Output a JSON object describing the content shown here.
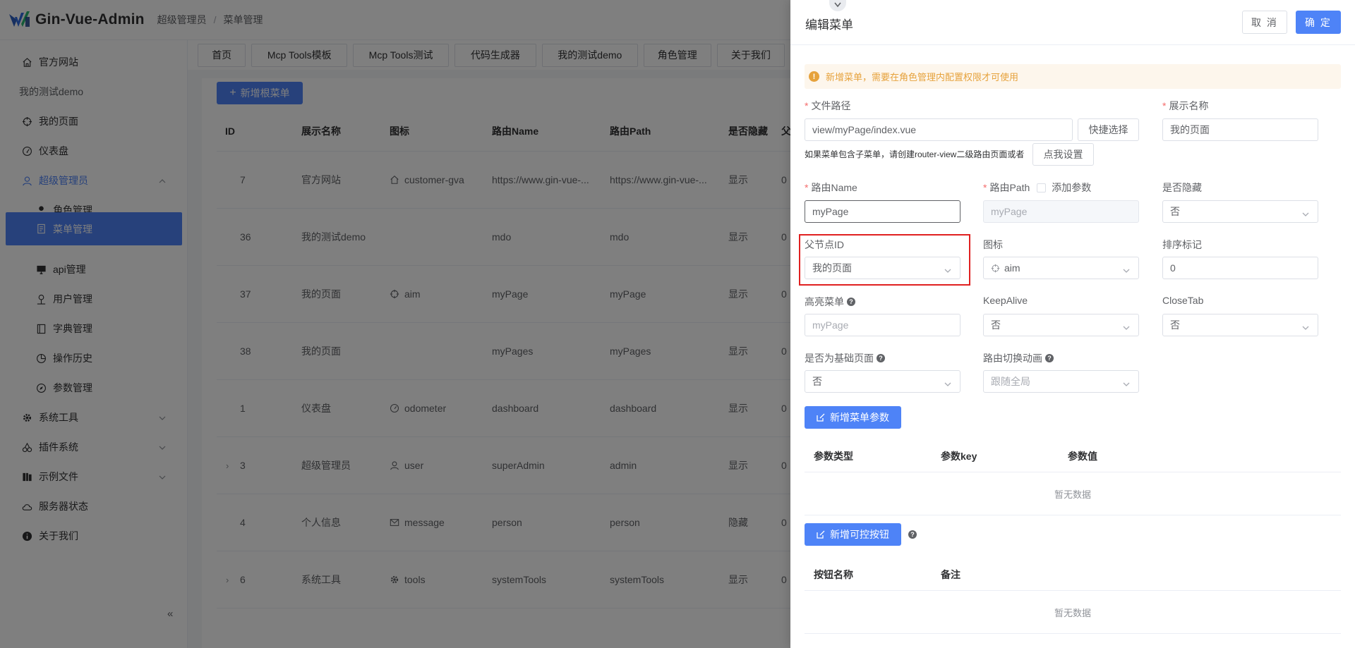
{
  "app": {
    "name": "Gin-Vue-Admin"
  },
  "breadcrumb": [
    "超级管理员",
    "菜单管理"
  ],
  "sidebar": {
    "items": [
      {
        "label": "官方网站",
        "icon": "home-icon"
      },
      {
        "label": "我的测试demo",
        "icon": ""
      },
      {
        "label": "我的页面",
        "icon": "aim-icon"
      },
      {
        "label": "仪表盘",
        "icon": "odometer-icon"
      },
      {
        "label": "超级管理员",
        "icon": "user-icon"
      },
      {
        "label": "角色管理",
        "icon": "avatar-icon"
      },
      {
        "label": "菜单管理",
        "icon": "tickets-icon"
      },
      {
        "label": "api管理",
        "icon": "platform-icon"
      },
      {
        "label": "用户管理",
        "icon": "coordinate-icon"
      },
      {
        "label": "字典管理",
        "icon": "notebook-icon"
      },
      {
        "label": "操作历史",
        "icon": "pie-chart-icon"
      },
      {
        "label": "参数管理",
        "icon": "compass-icon"
      },
      {
        "label": "系统工具",
        "icon": "tools-icon"
      },
      {
        "label": "插件系统",
        "icon": "cherry-icon"
      },
      {
        "label": "示例文件",
        "icon": "management-icon"
      },
      {
        "label": "服务器状态",
        "icon": "cloudy-icon"
      },
      {
        "label": "关于我们",
        "icon": "info-icon"
      }
    ],
    "collapse_glyph": "«"
  },
  "tabs": [
    "首页",
    "Mcp Tools模板",
    "Mcp Tools测试",
    "代码生成器",
    "我的测试demo",
    "角色管理",
    "关于我们"
  ],
  "main": {
    "add_root_label": "新增根菜单",
    "add_root_glyph": "+",
    "table": {
      "headers": [
        "ID",
        "展示名称",
        "图标",
        "路由Name",
        "路由Path",
        "是否隐藏",
        "父"
      ],
      "rows": [
        {
          "expand": "",
          "id": "7",
          "name": "官方网站",
          "icon": "customer-gva",
          "route_name": "https://www.gin-vue-...",
          "route_path": "https://www.gin-vue-...",
          "hidden": "显示",
          "more": "0"
        },
        {
          "expand": "",
          "id": "36",
          "name": "我的测试demo",
          "icon": "",
          "route_name": "mdo",
          "route_path": "mdo",
          "hidden": "显示",
          "more": "0"
        },
        {
          "expand": "",
          "id": "37",
          "name": "我的页面",
          "icon": "aim",
          "route_name": "myPage",
          "route_path": "myPage",
          "hidden": "显示",
          "more": "0"
        },
        {
          "expand": "",
          "id": "38",
          "name": "我的页面",
          "icon": "",
          "route_name": "myPages",
          "route_path": "myPages",
          "hidden": "显示",
          "more": "0"
        },
        {
          "expand": "",
          "id": "1",
          "name": "仪表盘",
          "icon": "odometer",
          "route_name": "dashboard",
          "route_path": "dashboard",
          "hidden": "显示",
          "more": "0"
        },
        {
          "expand": "›",
          "id": "3",
          "name": "超级管理员",
          "icon": "user",
          "route_name": "superAdmin",
          "route_path": "admin",
          "hidden": "显示",
          "more": "0"
        },
        {
          "expand": "",
          "id": "4",
          "name": "个人信息",
          "icon": "message",
          "route_name": "person",
          "route_path": "person",
          "hidden": "隐藏",
          "more": "0"
        },
        {
          "expand": "›",
          "id": "6",
          "name": "系统工具",
          "icon": "tools",
          "route_name": "systemTools",
          "route_path": "systemTools",
          "hidden": "显示",
          "more": "0"
        }
      ]
    }
  },
  "drawer": {
    "title": "编辑菜单",
    "cancel_label": "取 消",
    "ok_label": "确 定",
    "alert": "新增菜单，需要在角色管理内配置权限才可使用",
    "alert_glyph": "!",
    "required_mark": "*",
    "help_glyph": "?",
    "file_path": {
      "label": "文件路径",
      "value": "view/myPage/index.vue",
      "quick_btn": "快捷选择"
    },
    "display_name": {
      "label": "展示名称",
      "value": "我的页面"
    },
    "hint": "如果菜单包含子菜单，请创建router-view二级路由页面或者",
    "hint_btn": "点我设置",
    "route_name": {
      "label": "路由Name",
      "value": "myPage"
    },
    "route_path": {
      "label": "路由Path",
      "add_param": "添加参数",
      "placeholder": "myPage"
    },
    "is_hidden": {
      "label": "是否隐藏",
      "value": "否"
    },
    "parent_id": {
      "label": "父节点ID",
      "value": "我的页面"
    },
    "icon": {
      "label": "图标",
      "value": "aim"
    },
    "sort": {
      "label": "排序标记",
      "value": "0"
    },
    "active_menu": {
      "label": "高亮菜单",
      "placeholder": "myPage"
    },
    "keep_alive": {
      "label": "KeepAlive",
      "value": "否"
    },
    "close_tab": {
      "label": "CloseTab",
      "value": "否"
    },
    "is_base": {
      "label": "是否为基础页面",
      "value": "否"
    },
    "transition": {
      "label": "路由切换动画",
      "placeholder": "跟随全局"
    },
    "add_param_btn": "新增菜单参数",
    "param_table": {
      "headers": [
        "参数类型",
        "参数key",
        "参数值"
      ],
      "empty": "暂无数据"
    },
    "add_btn_btn": "新增可控按钮",
    "btn_table": {
      "headers": [
        "按钮名称",
        "备注"
      ],
      "empty": "暂无数据"
    }
  },
  "colors": {
    "primary": "#4e83f7",
    "warning": "#e6a23c",
    "danger": "#f56c6c",
    "highlight_box": "#e02020"
  }
}
